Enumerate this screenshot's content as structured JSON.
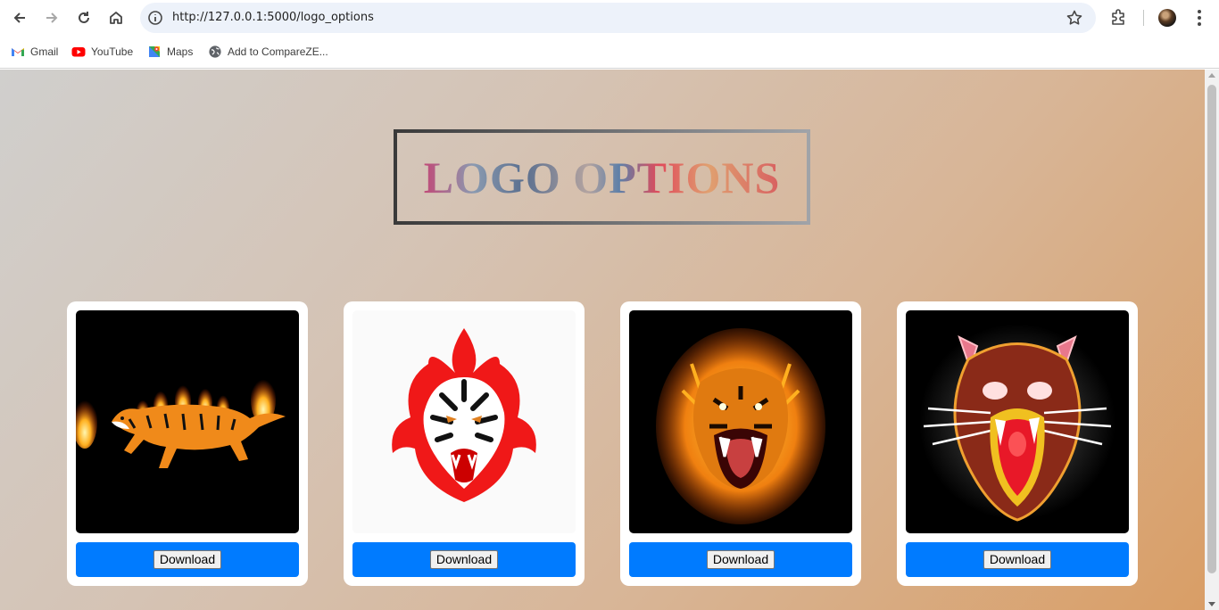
{
  "browser": {
    "url": "http://127.0.0.1:5000/logo_options",
    "bookmarks": [
      {
        "label": "Gmail",
        "icon": "gmail-icon"
      },
      {
        "label": "YouTube",
        "icon": "youtube-icon"
      },
      {
        "label": "Maps",
        "icon": "maps-icon"
      },
      {
        "label": "Add to CompareZE...",
        "icon": "globe-icon"
      }
    ]
  },
  "page": {
    "title": "LOGO OPTIONS",
    "accent_color": "#007bff",
    "cards": [
      {
        "image": "running-flaming-tiger-logo",
        "download_label": "Download"
      },
      {
        "image": "tiger-face-red-flames-logo",
        "download_label": "Download"
      },
      {
        "image": "roaring-tiger-fire-logo",
        "download_label": "Download"
      },
      {
        "image": "neon-tiger-face-logo",
        "download_label": "Download"
      }
    ]
  }
}
